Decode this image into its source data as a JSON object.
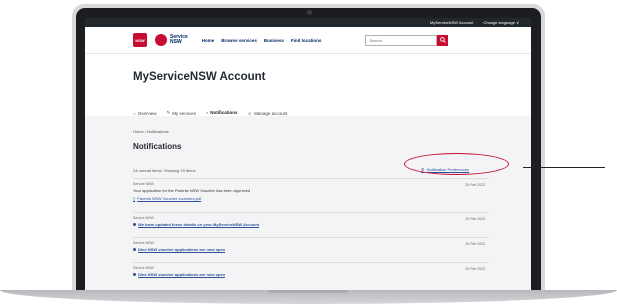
{
  "topbar": {
    "account": "MyServiceNSW Account",
    "language": "Change language ∨"
  },
  "header": {
    "logo_nsw": "NSW",
    "logo_service": "Service",
    "logo_nsw2": "NSW",
    "nav": [
      "Home",
      "Browse services",
      "Business",
      "Find locations"
    ],
    "search_placeholder": "Search"
  },
  "page_title": "MyServiceNSW Account",
  "tabs": [
    "Overview",
    "My services",
    "Notifications",
    "Manage account"
  ],
  "breadcrumb": "Home / Notifications",
  "notifications_title": "Notifications",
  "count_text": "24 unread items. Showing 15 items",
  "preferences_link": "Notification Preferences",
  "items": [
    {
      "sender": "Service NSW",
      "date": "20 Feb 2022",
      "message": "Your application for the Parents NSW Voucher has been approved",
      "link": "Parents NSW Voucher vouchers.pdf"
    },
    {
      "sender": "Service NSW",
      "date": "20 Feb 2022",
      "link": "We have updated these details on your MyServiceNSW Account"
    },
    {
      "sender": "Service NSW",
      "date": "20 Feb 2022",
      "link": "Dine NSW voucher applications are now open"
    },
    {
      "sender": "Service NSW",
      "date": "20 Feb 2022",
      "link": "Dine NSW voucher applications are now open"
    }
  ],
  "colors": {
    "brand_red": "#c60c30",
    "navy": "#002664",
    "link_blue": "#2e5299",
    "highlight": "#c60c30"
  }
}
